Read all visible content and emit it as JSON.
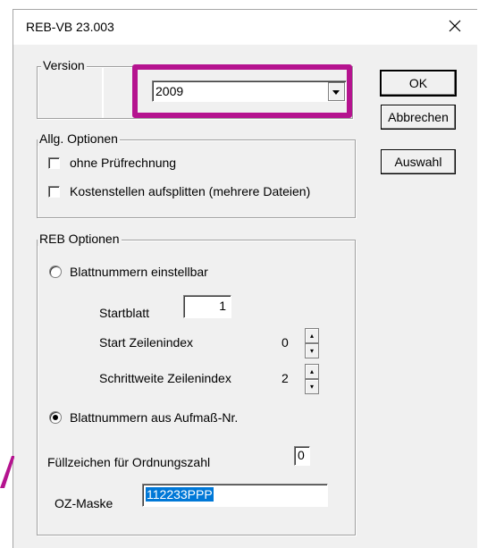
{
  "window": {
    "title": "REB-VB 23.003"
  },
  "version_group": {
    "legend": "Version",
    "selected_value": "2009"
  },
  "buttons": {
    "ok": "OK",
    "cancel": "Abbrechen",
    "select": "Auswahl"
  },
  "general_options": {
    "legend": "Allg. Optionen",
    "no_check_calc": {
      "label": "ohne Prüfrechnung",
      "checked": false
    },
    "split_cost_centers": {
      "label": "Kostenstellen aufsplitten (mehrere Dateien)",
      "checked": false
    }
  },
  "reb_options": {
    "legend": "REB Optionen",
    "radio_adjustable": {
      "label": "Blattnummern einstellbar",
      "checked": false
    },
    "start_sheet": {
      "label": "Startblatt",
      "value": "1"
    },
    "start_row_index": {
      "label": "Start Zeilenindex",
      "value": "0"
    },
    "row_index_step": {
      "label": "Schrittweite Zeilenindex",
      "value": "2"
    },
    "radio_from_measurement": {
      "label": "Blattnummern aus Aufmaß-Nr.",
      "checked": true
    },
    "fill_char": {
      "label": "Füllzeichen für Ordnungszahl",
      "value": "0"
    },
    "oz_mask": {
      "label": "OZ-Maske",
      "value": "112233PPP"
    }
  },
  "colors": {
    "highlight": "#b5138f",
    "selection": "#0078d7"
  },
  "icons": {
    "close": "close-icon",
    "combo": "chevron-down-icon",
    "spin": "spin-arrows-icon"
  }
}
